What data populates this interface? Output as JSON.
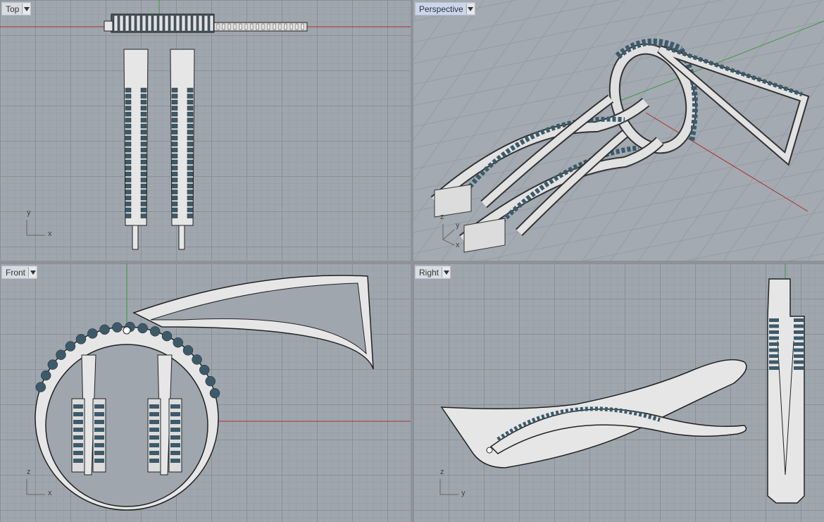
{
  "viewports": {
    "top": {
      "label": "Top",
      "axis_x": "x",
      "axis_y": "y"
    },
    "perspective": {
      "label": "Perspective",
      "axis_x": "x",
      "axis_y": "y",
      "axis_z": "z"
    },
    "front": {
      "label": "Front",
      "axis_x": "x",
      "axis_z": "z"
    },
    "right": {
      "label": "Right",
      "axis_y": "y",
      "axis_z": "z"
    }
  },
  "colors": {
    "viewport_bg": "#9fa6ae",
    "active_tab": "#c9d6ec",
    "model_fill": "#e6e6e6",
    "gem": "#3c5a6a",
    "x_axis": "#b0302a",
    "y_axis": "#3c9a3c"
  },
  "icons": {
    "dropdown": "chevron-down-icon"
  }
}
